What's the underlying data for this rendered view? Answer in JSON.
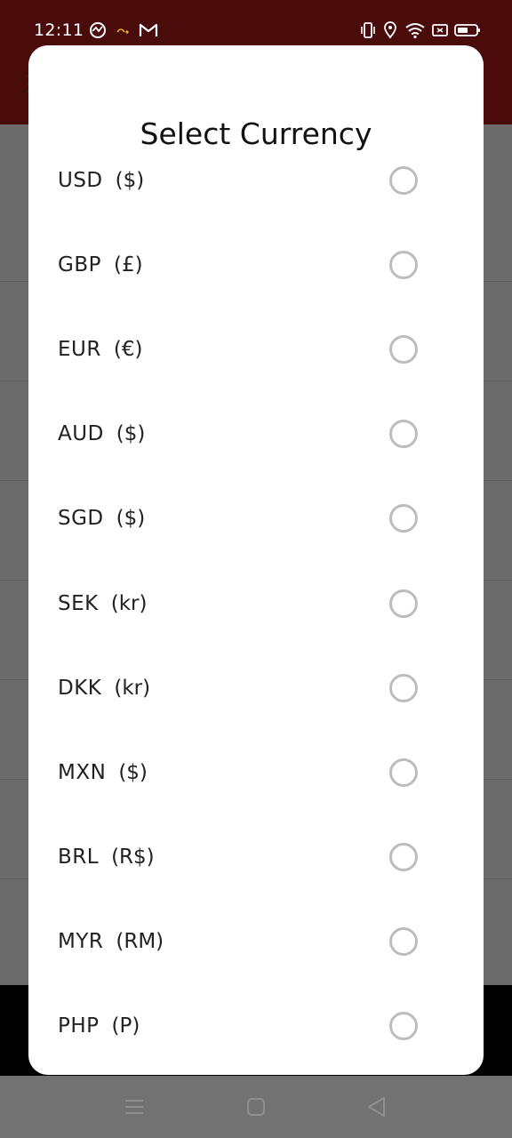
{
  "status_bar": {
    "time": "12:11",
    "left_icons": [
      "activity-icon",
      "cast-icon",
      "gmail-icon"
    ],
    "right_icons": [
      "vibrate-icon",
      "location-icon",
      "wifi-icon",
      "screen-icon",
      "battery-icon"
    ]
  },
  "dialog": {
    "title": "Select Currency",
    "currencies": [
      {
        "code": "USD",
        "symbol": "($)",
        "selected": false
      },
      {
        "code": "GBP",
        "symbol": "(£)",
        "selected": false
      },
      {
        "code": "EUR",
        "symbol": "(€)",
        "selected": false
      },
      {
        "code": "AUD",
        "symbol": "($)",
        "selected": false
      },
      {
        "code": "SGD",
        "symbol": "($)",
        "selected": false
      },
      {
        "code": "SEK",
        "symbol": "(kr)",
        "selected": false
      },
      {
        "code": "DKK",
        "symbol": "(kr)",
        "selected": false
      },
      {
        "code": "MXN",
        "symbol": "($)",
        "selected": false
      },
      {
        "code": "BRL",
        "symbol": "(R$)",
        "selected": false
      },
      {
        "code": "MYR",
        "symbol": "(RM)",
        "selected": false
      },
      {
        "code": "PHP",
        "symbol": "(P)",
        "selected": false
      }
    ]
  },
  "nav_bar": {
    "buttons": [
      "menu-icon",
      "home-icon",
      "back-icon"
    ]
  },
  "colors": {
    "app_header": "#4a0b0b",
    "scrim_gray": "#6e6e6e",
    "radio_border": "#bdbdbd"
  }
}
